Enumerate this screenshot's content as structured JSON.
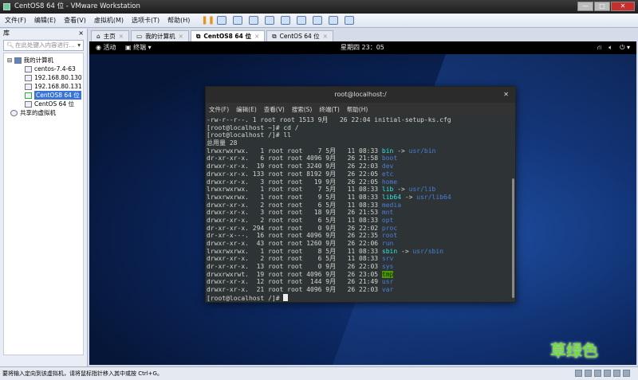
{
  "window": {
    "title": "CentOS8 64 位 - VMware Workstation",
    "minimize": "—",
    "maximize": "□",
    "close": "✕"
  },
  "menu": [
    "文件(F)",
    "编辑(E)",
    "查看(V)",
    "虚拟机(M)",
    "选项卡(T)",
    "帮助(H)"
  ],
  "sidebar": {
    "title": "库",
    "close": "×",
    "search_placeholder": "在此处键入内容进行...",
    "tree_root": "我的计算机",
    "vms": [
      "centos-7.4-63",
      "192.168.80.130",
      "192.168.80.131",
      "CentOS8 64 位",
      "CentOS 64 位"
    ],
    "selected_index": 3,
    "shared": "共享的虚拟机"
  },
  "tabs": [
    {
      "label": "主页"
    },
    {
      "label": "我的计算机"
    },
    {
      "label": "CentOS8 64 位",
      "active": true
    },
    {
      "label": "CentOS 64 位"
    }
  ],
  "gnome": {
    "activities": "活动",
    "terminal_menu": "终端 ▾",
    "clock": "星期四 23：05"
  },
  "terminal": {
    "title": "root@localhost:/",
    "menu": [
      "文件(F)",
      "编辑(E)",
      "查看(V)",
      "搜索(S)",
      "终端(T)",
      "帮助(H)"
    ],
    "lines": [
      {
        "t": "-rw-r--r--. 1 root root 1513 9月   26 22:04 initial-setup-ks.cfg"
      },
      {
        "t": "[root@localhost ~]# cd /"
      },
      {
        "t": "[root@localhost /]# ll"
      },
      {
        "t": "总用量 28"
      },
      {
        "t": "lrwxrwxrwx.   1 root root    7 5月   11 08:33 ",
        "n": "bin",
        "c": "lk",
        "a": " -> ",
        "g": "usr/bin"
      },
      {
        "t": "dr-xr-xr-x.   6 root root 4096 9月   26 21:58 ",
        "n": "boot",
        "c": "dr"
      },
      {
        "t": "drwxr-xr-x.  19 root root 3240 9月   26 22:03 ",
        "n": "dev",
        "c": "dr"
      },
      {
        "t": "drwxr-xr-x. 133 root root 8192 9月   26 22:05 ",
        "n": "etc",
        "c": "dr"
      },
      {
        "t": "drwxr-xr-x.   3 root root   19 9月   26 22:05 ",
        "n": "home",
        "c": "dr"
      },
      {
        "t": "lrwxrwxrwx.   1 root root    7 5月   11 08:33 ",
        "n": "lib",
        "c": "lk",
        "a": " -> ",
        "g": "usr/lib"
      },
      {
        "t": "lrwxrwxrwx.   1 root root    9 5月   11 08:33 ",
        "n": "lib64",
        "c": "lk",
        "a": " -> ",
        "g": "usr/lib64"
      },
      {
        "t": "drwxr-xr-x.   2 root root    6 5月   11 08:33 ",
        "n": "media",
        "c": "dr"
      },
      {
        "t": "drwxr-xr-x.   3 root root   18 9月   26 21:53 ",
        "n": "mnt",
        "c": "dr"
      },
      {
        "t": "drwxr-xr-x.   2 root root    6 5月   11 08:33 ",
        "n": "opt",
        "c": "dr"
      },
      {
        "t": "dr-xr-xr-x. 294 root root    0 9月   26 22:02 ",
        "n": "proc",
        "c": "dr"
      },
      {
        "t": "dr-xr-x---.  16 root root 4096 9月   26 22:35 ",
        "n": "root",
        "c": "dr"
      },
      {
        "t": "drwxr-xr-x.  43 root root 1260 9月   26 22:06 ",
        "n": "run",
        "c": "dr"
      },
      {
        "t": "lrwxrwxrwx.   1 root root    8 5月   11 08:33 ",
        "n": "sbin",
        "c": "lk",
        "a": " -> ",
        "g": "usr/sbin"
      },
      {
        "t": "drwxr-xr-x.   2 root root    6 5月   11 08:33 ",
        "n": "srv",
        "c": "dr"
      },
      {
        "t": "dr-xr-xr-x.  13 root root    0 9月   26 22:03 ",
        "n": "sys",
        "c": "dr"
      },
      {
        "t": "drwxrwxrwt.  19 root root 4096 9月   26 23:05 ",
        "n": "tmp",
        "c": "tg"
      },
      {
        "t": "drwxr-xr-x.  12 root root  144 9月   26 21:49 ",
        "n": "usr",
        "c": "dr"
      },
      {
        "t": "drwxr-xr-x.  21 root root 4096 9月   26 22:03 ",
        "n": "var",
        "c": "dr"
      },
      {
        "t": "[root@localhost /]# ",
        "cursor": true
      }
    ]
  },
  "watermark": "草绿色",
  "status": "要将输入定向到该虚拟机，请将鼠标指针移入其中或按 Ctrl+G。"
}
